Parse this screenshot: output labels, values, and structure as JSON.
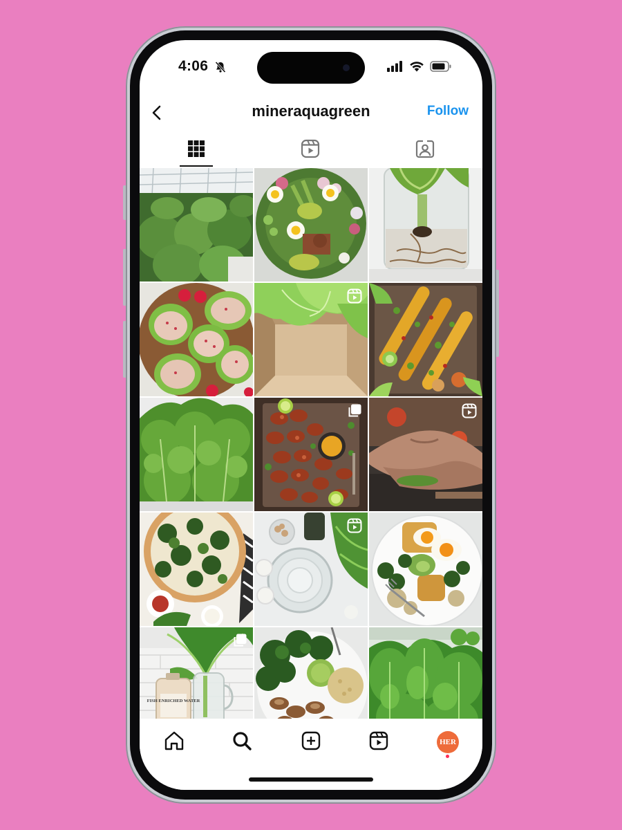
{
  "status_bar": {
    "time": "4:06",
    "icons": [
      "bell-slash-icon",
      "signal-icon",
      "wifi-icon",
      "battery-icon"
    ]
  },
  "header": {
    "back_icon": "chevron-left-icon",
    "username": "mineraquagreen",
    "follow_label": "Follow"
  },
  "tabs": [
    {
      "name": "posts-grid",
      "icon": "grid-icon",
      "selected": true
    },
    {
      "name": "reels",
      "icon": "reels-icon",
      "selected": false
    },
    {
      "name": "tagged",
      "icon": "tagged-person-icon",
      "selected": false
    }
  ],
  "grid_posts": [
    {
      "subject": "greenhouse lettuce rows",
      "badge": ""
    },
    {
      "subject": "egg and vegetable salad bowl",
      "badge": ""
    },
    {
      "subject": "lettuce rooted in water jar",
      "badge": ""
    },
    {
      "subject": "lettuce cups with tuna salad",
      "badge": ""
    },
    {
      "subject": "lettuce in cardboard box",
      "badge": "reel-icon"
    },
    {
      "subject": "grilled corn platter",
      "badge": ""
    },
    {
      "subject": "curly kale leaves",
      "badge": ""
    },
    {
      "subject": "spicy shrimp platter",
      "badge": "carousel-icon"
    },
    {
      "subject": "hands cooking",
      "badge": "reel-icon"
    },
    {
      "subject": "kale pizza",
      "badge": ""
    },
    {
      "subject": "glass water pitcher with greens",
      "badge": "reel-icon"
    },
    {
      "subject": "eggs with greens on toast",
      "badge": ""
    },
    {
      "subject": "greens in jar with water jug",
      "badge": "carousel-icon",
      "label": "FISH ENRICHED WATER"
    },
    {
      "subject": "greens with guacamole and mushrooms",
      "badge": ""
    },
    {
      "subject": "romaine lettuce plants",
      "badge": ""
    }
  ],
  "bottom_nav": {
    "items": [
      "home-icon",
      "search-icon",
      "create-icon",
      "reels-icon",
      "profile-avatar"
    ],
    "avatar_text": "HER"
  },
  "colors": {
    "background": "#ea7fc0",
    "follow": "#1a93ee",
    "avatar": "#ee6b3a"
  }
}
